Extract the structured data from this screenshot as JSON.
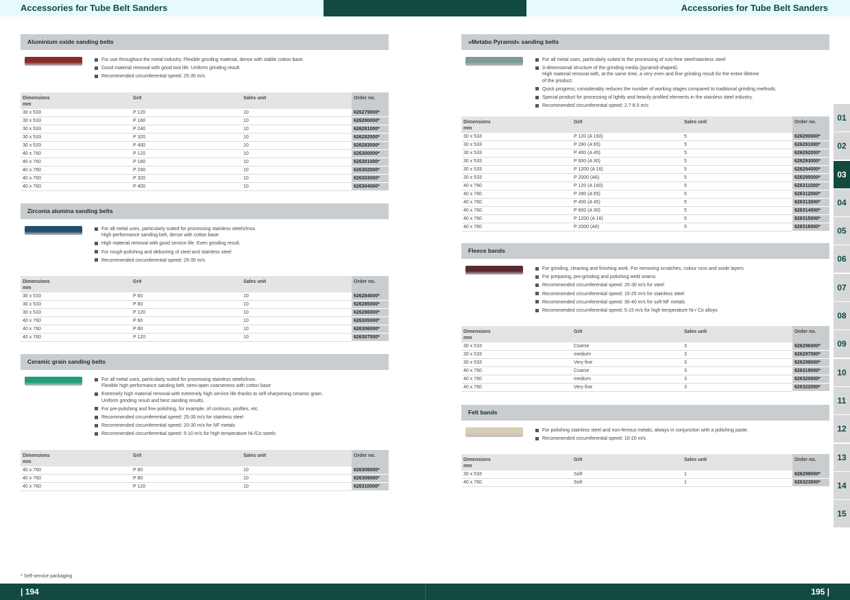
{
  "header": {
    "left_title": "Accessories for Tube Belt Sanders",
    "right_title": "Accessories for Tube Belt Sanders"
  },
  "table_headers": {
    "dimensions": "Dimensions\nmm",
    "grit": "Grit",
    "sales_unit": "Sales unit",
    "order_no": "Order no."
  },
  "colors": {
    "brand_dark": "#134a40",
    "header_light": "#e6fafb",
    "section_grey": "#c9cdcf"
  },
  "sections": [
    {
      "title": "Aluminium oxide sanding belts",
      "belt_color": "#8a2a2a",
      "bullets": [
        "For use throughout the metal industry. Flexible grinding material, dense with stable cotton base.",
        "Good material removal with good tool life. Uniform grinding result.",
        "Recommended circumferential speed: 25-35 m/s"
      ],
      "rows": [
        [
          "30 x 533",
          "P 120",
          "10",
          "626279000*"
        ],
        [
          "30 x 533",
          "P 180",
          "10",
          "626280000*"
        ],
        [
          "30 x 533",
          "P 240",
          "10",
          "626281000*"
        ],
        [
          "30 x 533",
          "P 320",
          "10",
          "626282000*"
        ],
        [
          "30 x 533",
          "P 400",
          "10",
          "626283000*"
        ],
        [
          "40 x 760",
          "P 120",
          "10",
          "626300000*"
        ],
        [
          "40 x 760",
          "P 180",
          "10",
          "626301000*"
        ],
        [
          "40 x 760",
          "P 240",
          "10",
          "626302000*"
        ],
        [
          "40 x 760",
          "P 320",
          "10",
          "626303000*"
        ],
        [
          "40 x 760",
          "P 400",
          "10",
          "626304000*"
        ]
      ]
    },
    {
      "title": "Zirconia alumina sanding belts",
      "belt_color": "#1f4f6a",
      "bullets": [
        "For all metal uses, particularly suited for processing stainless steels/Inox.\nHigh performance sanding belt, dense with cotton base.",
        "High material removal with good service life. Even grinding result.",
        "For rough-polishing and deburring of steel and stainless steel",
        "Recommended circumferential speed: 25-35 m/s"
      ],
      "rows": [
        [
          "30 x 533",
          "P 60",
          "10",
          "626284000*"
        ],
        [
          "30 x 533",
          "P 80",
          "10",
          "626285000*"
        ],
        [
          "30 x 533",
          "P 120",
          "10",
          "626286000*"
        ],
        [
          "40 x 760",
          "P 60",
          "10",
          "626305000*"
        ],
        [
          "40 x 760",
          "P 80",
          "10",
          "626306000*"
        ],
        [
          "40 x 760",
          "P 120",
          "10",
          "626307000*"
        ]
      ]
    },
    {
      "title": "Ceramic grain sanding belts",
      "belt_color": "#1f9e7a",
      "bullets": [
        "For all metal uses, particularly suited for processing stainless steels/Inox.\nFlexible high performance sanding belt, semi-open coarseness with cotton base",
        "Extremely high material removal with extremely high service life thanks to self-sharpening ceramic grain.\nUniform grinding result and best sanding results.",
        "For pre-polishing and fine polishing, for example, of contours, profiles, etc.",
        "Recommended circumferential speed: 25-35 m/s for stainless steel",
        "Recommended circumferential speed: 20-30 m/s for NF metals",
        "Recommended circumferential speed: 5-10 m/s for high temperature Ni-/Co steels"
      ],
      "rows": [
        [
          "40 x 760",
          "P 60",
          "10",
          "626308000*"
        ],
        [
          "40 x 760",
          "P 80",
          "10",
          "626309000*"
        ],
        [
          "40 x 760",
          "P 120",
          "10",
          "626310000*"
        ]
      ]
    },
    {
      "title": "»Metabo Pyramid« sanding belts",
      "belt_color": "#7d9a96",
      "bullets": [
        "For all metal uses, particularly suited to the processing of rust-free steel/stainless steel",
        "3-dimensional structure of the grinding media (pyramid-shaped).\nHigh material removal with, at the same time, a very even and fine grinding result for the entire lifetime\nof the product.",
        "Quick progress; considerably reduces the number of working stages compared to traditional grinding methods.",
        "Special product for processing of lightly and heavily profiled elements in the stainless steel industry.",
        "Recommended circumferential speed: 2.7-8.5 m/s"
      ],
      "rows": [
        [
          "30 x 533",
          "P 120 (A 160)",
          "5",
          "626290000*"
        ],
        [
          "30 x 533",
          "P 280 (A 65)",
          "5",
          "626291000*"
        ],
        [
          "30 x 533",
          "P 400 (A 45)",
          "5",
          "626292000*"
        ],
        [
          "30 x 533",
          "P 600 (A 30)",
          "5",
          "626293000*"
        ],
        [
          "30 x 533",
          "P 1200 (A 16)",
          "5",
          "626294000*"
        ],
        [
          "30 x 533",
          "P 2000 (A6)",
          "5",
          "626295000*"
        ],
        [
          "40 x 760",
          "P 120 (A 160)",
          "5",
          "626311000*"
        ],
        [
          "40 x 760",
          "P 280 (A 65)",
          "5",
          "626312000*"
        ],
        [
          "40 x 760",
          "P 400 (A 45)",
          "5",
          "626313000*"
        ],
        [
          "40 x 760",
          "P 600 (A 30)",
          "5",
          "626314000*"
        ],
        [
          "40 x 760",
          "P 1200 (A 16)",
          "5",
          "626315000*"
        ],
        [
          "40 x 760",
          "P 2000 (A6)",
          "5",
          "626316000*"
        ]
      ]
    },
    {
      "title": "Fleece bands",
      "belt_color": "#5a2a30",
      "bullets": [
        "For grinding, cleaning and finishing work. For removing scratches, colour runs and oxide layers.",
        "For preparing, pre-grinding and polishing weld seams",
        "Recommended circumferential speed: 25-30 m/s for steel",
        "Recommended circumferential speed: 15-25 m/s for stainless steel",
        "Recommended circumferential speed: 30-40 m/s for soft NF metals",
        "Recommended circumferential speed: 5-15 m/s for high temperature Ni-/ Co alloys"
      ],
      "rows": [
        [
          "30 x 533",
          "Coarse",
          "3",
          "626296000*"
        ],
        [
          "30 x 533",
          "medium",
          "3",
          "626297000*"
        ],
        [
          "30 x 533",
          "Very fine",
          "3",
          "626298000*"
        ],
        [
          "40 x 760",
          "Coarse",
          "3",
          "626319000*"
        ],
        [
          "40 x 760",
          "medium",
          "3",
          "626320000*"
        ],
        [
          "40 x 760",
          "Very fine",
          "3",
          "626322000*"
        ]
      ]
    },
    {
      "title": "Felt bands",
      "belt_color": "#d8cdb4",
      "bullets": [
        "For polishing stainless steel and non-ferrous metals, always in conjunction with a polishing paste.",
        "Recommended circumferential speed: 10-20 m/s"
      ],
      "rows": [
        [
          "30 x 533",
          "Soft",
          "1",
          "626299000*"
        ],
        [
          "40 x 760",
          "Soft",
          "1",
          "626323000*"
        ]
      ]
    }
  ],
  "footnote": "* Self-service packaging",
  "footer": {
    "left_page": "| 194",
    "right_page": "195 |"
  },
  "tabs": [
    "01",
    "02",
    "03",
    "04",
    "05",
    "06",
    "07",
    "08",
    "09",
    "10",
    "11",
    "12",
    "13",
    "14",
    "15"
  ],
  "active_tab": "03"
}
